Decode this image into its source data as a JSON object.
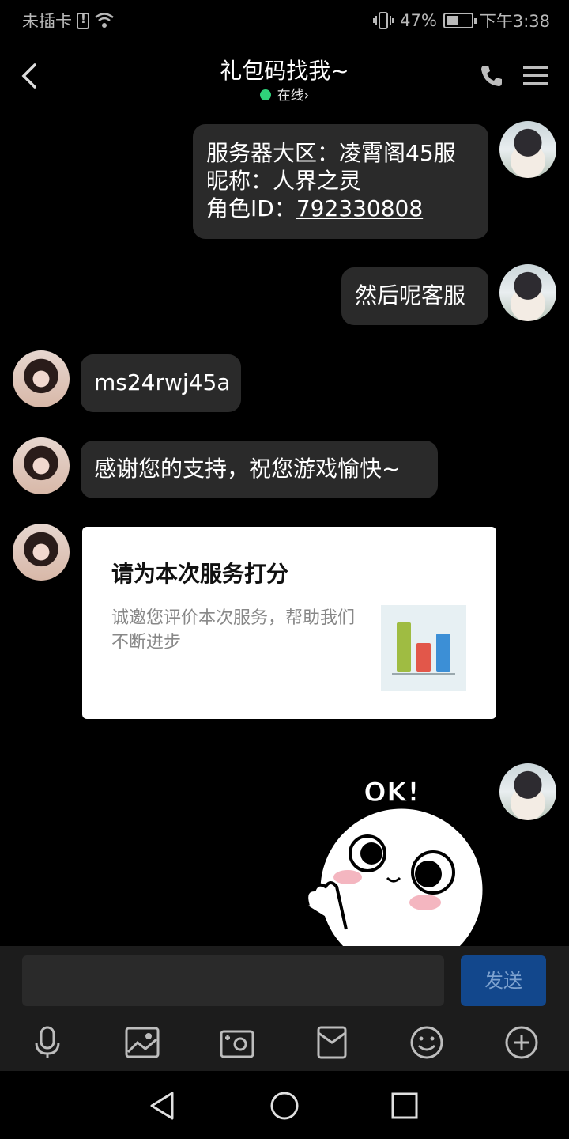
{
  "status_bar": {
    "carrier": "未插卡",
    "battery_text": "47%",
    "battery_level": 0.47,
    "time": "下午3:38"
  },
  "header": {
    "title": "礼包码找我~",
    "status": "在线",
    "status_chevron": "›",
    "online_color": "#2fd37a"
  },
  "messages": [
    {
      "sender": "self",
      "lines": [
        "服务器大区：凌霄阁45服",
        "昵称：人界之灵"
      ],
      "id_label": "角色ID：",
      "id_value": "792330808"
    },
    {
      "sender": "self",
      "text": "然后呢客服"
    },
    {
      "sender": "service",
      "text": "ms24rwj45a"
    },
    {
      "sender": "service",
      "text": "感谢您的支持，祝您游戏愉快~"
    }
  ],
  "rating_card": {
    "title": "请为本次服务打分",
    "description": "诚邀您评价本次服务，帮助我们不断进步",
    "bar_colors": [
      "#9fbc42",
      "#e2574a",
      "#3c8fd6"
    ]
  },
  "sticker": {
    "text": "OK!"
  },
  "composer": {
    "placeholder": "",
    "send_label": "发送",
    "send_color": "#12478c"
  },
  "toolbar": {
    "icons": [
      "microphone-icon",
      "image-icon",
      "camera-icon",
      "red-packet-icon",
      "emoji-icon",
      "plus-icon"
    ]
  }
}
